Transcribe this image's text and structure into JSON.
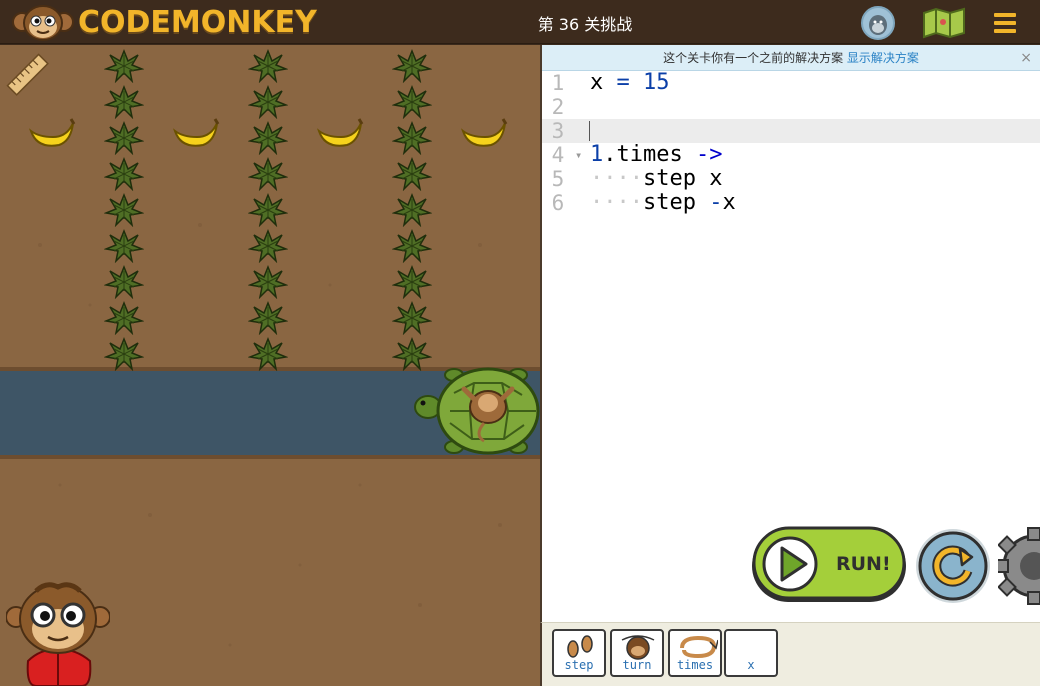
{
  "header": {
    "logo_text": "CODEMONKEY",
    "level_title": "第 36 关挑战",
    "icons": {
      "avatar": "gorilla-avatar-icon",
      "map": "map-icon",
      "menu": "hamburger-menu-icon"
    }
  },
  "editor": {
    "notice_text": "这个关卡你有一个之前的解决方案 ",
    "notice_link": "显示解决方案",
    "notice_close": "×",
    "lines": [
      {
        "n": "1"
      },
      {
        "n": "2"
      },
      {
        "n": "3"
      },
      {
        "n": "4"
      },
      {
        "n": "5"
      },
      {
        "n": "6"
      }
    ],
    "code": {
      "l1_var": "x",
      "l1_eq": " = ",
      "l1_val": "15",
      "l4_num": "1",
      "l4_rest": ".times ",
      "l4_arrow": "->",
      "l5_indent": "····",
      "l5_text": "step x",
      "l6_indent": "····",
      "l6_step": "step ",
      "l6_op": "-",
      "l6_var": "x"
    }
  },
  "controls": {
    "run_label": "RUN!",
    "reset": "reset-icon",
    "settings": "gear-icon"
  },
  "palette": {
    "items": [
      {
        "label": "step"
      },
      {
        "label": "turn"
      },
      {
        "label": "times"
      },
      {
        "label": "x"
      }
    ]
  },
  "colors": {
    "accent": "#f2b52a",
    "run_green": "#9acd32",
    "reset_blue": "#8ab4cc",
    "ground": "#8a6642",
    "river": "#3e5566"
  }
}
